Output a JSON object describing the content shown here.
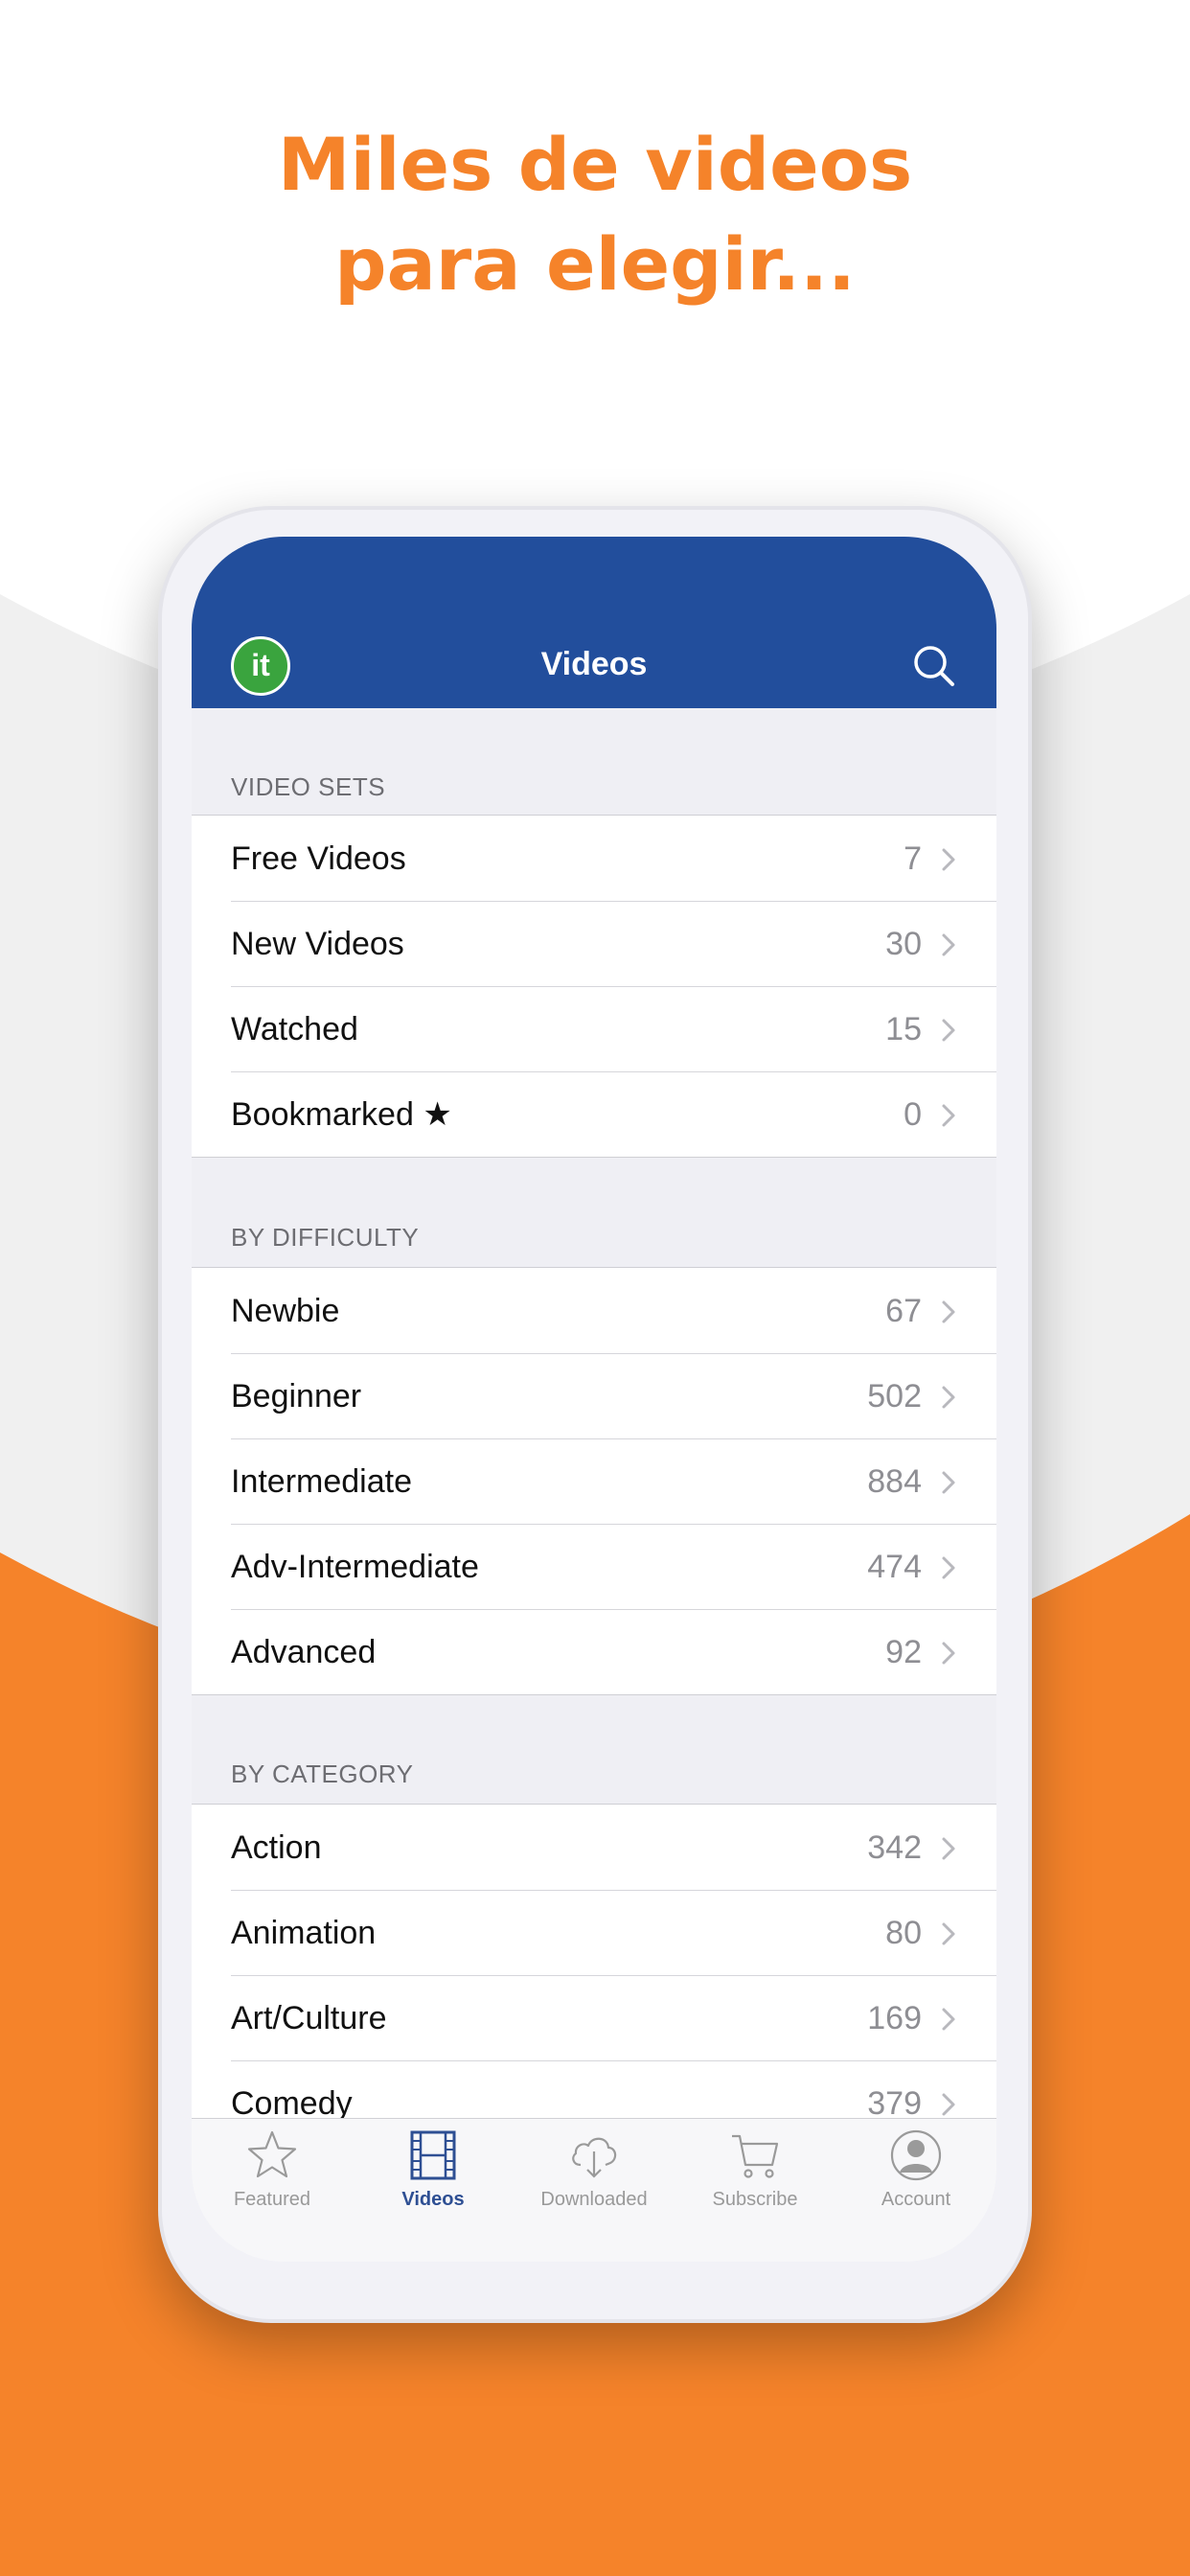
{
  "promo": {
    "headline_line1": "Miles de videos",
    "headline_line2": "para elegir..."
  },
  "colors": {
    "accent_orange": "#f5832a",
    "nav_blue": "#224e9c",
    "logo_green": "#3aa43e",
    "active_tab": "#2e4f93"
  },
  "app": {
    "logo_text": "it",
    "title": "Videos",
    "search_icon": "search-icon"
  },
  "sections": [
    {
      "header": "VIDEO SETS",
      "rows": [
        {
          "label": "Free Videos",
          "count": "7"
        },
        {
          "label": "New Videos",
          "count": "30"
        },
        {
          "label": "Watched",
          "count": "15"
        },
        {
          "label": "Bookmarked",
          "count": "0",
          "icon": "star-icon"
        }
      ]
    },
    {
      "header": "BY DIFFICULTY",
      "rows": [
        {
          "label": "Newbie",
          "count": "67"
        },
        {
          "label": "Beginner",
          "count": "502"
        },
        {
          "label": "Intermediate",
          "count": "884"
        },
        {
          "label": "Adv-Intermediate",
          "count": "474"
        },
        {
          "label": "Advanced",
          "count": "92"
        }
      ]
    },
    {
      "header": "BY CATEGORY",
      "rows": [
        {
          "label": "Action",
          "count": "342"
        },
        {
          "label": "Animation",
          "count": "80"
        },
        {
          "label": "Art/Culture",
          "count": "169"
        },
        {
          "label": "Comedy",
          "count": "379"
        }
      ]
    }
  ],
  "tabbar": {
    "active": "Videos",
    "tabs": [
      {
        "label": "Featured",
        "icon": "star-icon"
      },
      {
        "label": "Videos",
        "icon": "film-icon"
      },
      {
        "label": "Downloaded",
        "icon": "cloud-download-icon"
      },
      {
        "label": "Subscribe",
        "icon": "cart-icon"
      },
      {
        "label": "Account",
        "icon": "user-icon"
      }
    ]
  }
}
